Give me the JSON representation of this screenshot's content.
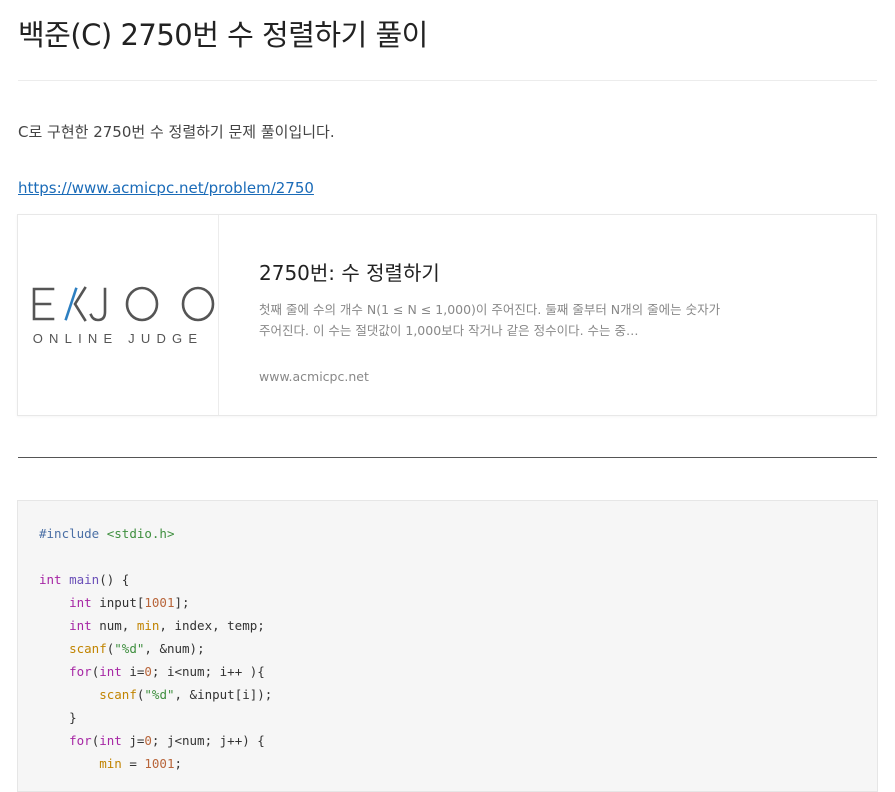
{
  "post": {
    "title": "백준(C) 2750번 수 정렬하기 풀이",
    "intro": "C로 구현한 2750번 수 정렬하기 문제 풀이입니다.",
    "link_text": "https://www.acmicpc.net/problem/2750"
  },
  "card": {
    "logo": {
      "word": "EKJOO",
      "tagline": "ONLINE JUDGE",
      "text_color": "#555555",
      "accent_color": "#2d7fc1"
    },
    "title": "2750번: 수 정렬하기",
    "description": "첫째 줄에 수의 개수 N(1 ≤ N ≤ 1,000)이 주어진다. 둘째 줄부터 N개의 줄에는 숫자가 주어진다. 이 수는 절댓값이 1,000보다 작거나 같은 정수이다. 수는 중…",
    "domain": "www.acmicpc.net"
  },
  "code": {
    "lines": [
      [
        {
          "t": "#include",
          "c": "pp"
        },
        {
          "t": " "
        },
        {
          "t": "<stdio.h>",
          "c": "str"
        }
      ],
      [],
      [
        {
          "t": "int",
          "c": "kw"
        },
        {
          "t": " "
        },
        {
          "t": "main",
          "c": "fn"
        },
        {
          "t": "() {"
        }
      ],
      [
        {
          "t": "    "
        },
        {
          "t": "int",
          "c": "kw"
        },
        {
          "t": " input["
        },
        {
          "t": "1001",
          "c": "num"
        },
        {
          "t": "];"
        }
      ],
      [
        {
          "t": "    "
        },
        {
          "t": "int",
          "c": "kw"
        },
        {
          "t": " num, "
        },
        {
          "t": "min",
          "c": "call"
        },
        {
          "t": ", index, temp;"
        }
      ],
      [
        {
          "t": "    "
        },
        {
          "t": "scanf",
          "c": "call"
        },
        {
          "t": "("
        },
        {
          "t": "\"%d\"",
          "c": "str"
        },
        {
          "t": ", &num);"
        }
      ],
      [
        {
          "t": "    "
        },
        {
          "t": "for",
          "c": "kw"
        },
        {
          "t": "("
        },
        {
          "t": "int",
          "c": "kw"
        },
        {
          "t": " i="
        },
        {
          "t": "0",
          "c": "num"
        },
        {
          "t": "; i<num; i++ ){"
        }
      ],
      [
        {
          "t": "        "
        },
        {
          "t": "scanf",
          "c": "call"
        },
        {
          "t": "("
        },
        {
          "t": "\"%d\"",
          "c": "str"
        },
        {
          "t": ", &input[i]);"
        }
      ],
      [
        {
          "t": "    }"
        }
      ],
      [
        {
          "t": "    "
        },
        {
          "t": "for",
          "c": "kw"
        },
        {
          "t": "("
        },
        {
          "t": "int",
          "c": "kw"
        },
        {
          "t": " j="
        },
        {
          "t": "0",
          "c": "num"
        },
        {
          "t": "; j<num; j++) {"
        }
      ],
      [
        {
          "t": "        "
        },
        {
          "t": "min",
          "c": "call"
        },
        {
          "t": " = "
        },
        {
          "t": "1001",
          "c": "num"
        },
        {
          "t": ";"
        }
      ]
    ]
  }
}
